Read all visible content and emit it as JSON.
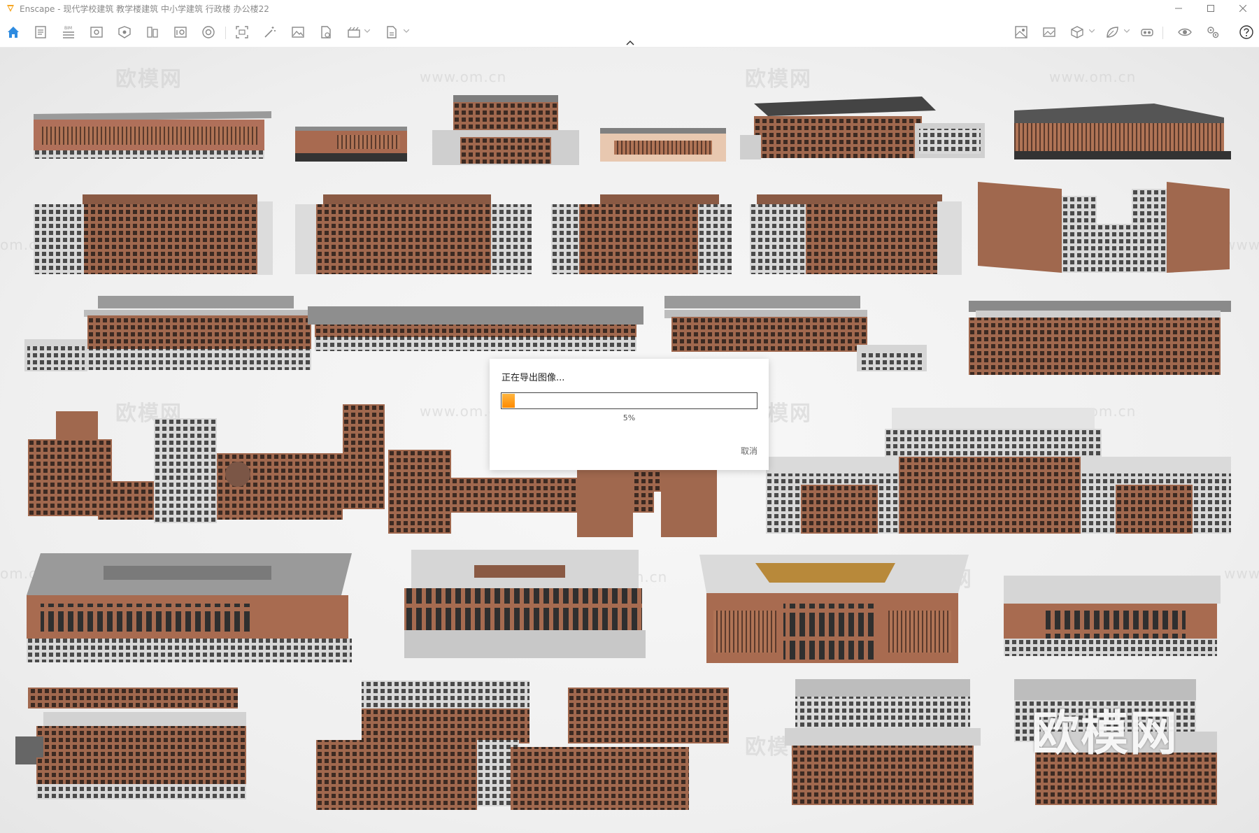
{
  "window": {
    "title": "Enscape - 现代学校建筑 教学楼建筑 中小学建筑 行政楼 办公楼22",
    "accent_color": "#f5a623"
  },
  "toolbar": {
    "left_icons": [
      "home-icon",
      "document-icon",
      "bim-list-icon",
      "visual-settings-icon",
      "asset-library-icon",
      "material-editor-icon",
      "info-panel-icon",
      "sphere-settings-icon",
      "screenshot-capture-icon",
      "magic-wand-icon",
      "image-render-icon",
      "export-icon",
      "video-export-icon",
      "batch-export-icon"
    ],
    "right_icons": [
      "image-gallery-icon",
      "picture-icon",
      "cube-view-icon",
      "leaf-tool-icon",
      "vr-headset-icon",
      "eye-preview-icon",
      "settings-gears-icon",
      "help-icon"
    ],
    "bim_label": "BIM"
  },
  "watermarks": {
    "brand": "欧模网",
    "url": "www.om.cn",
    "partial": "om.cn",
    "partial_right": "www."
  },
  "dialog": {
    "title": "正在导出图像...",
    "progress_percent": 5,
    "progress_text": "5%",
    "cancel_label": "取消",
    "fill_color": "#ff9a10"
  }
}
